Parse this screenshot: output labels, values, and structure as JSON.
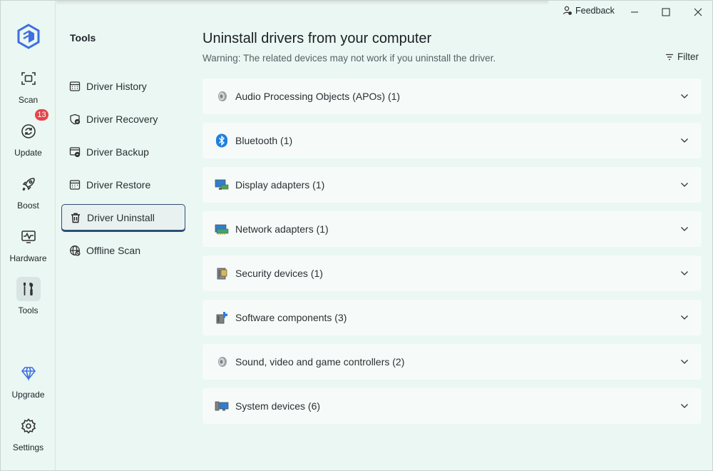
{
  "titlebar": {
    "feedback_label": "Feedback",
    "minimize_icon": "minimize-icon",
    "maximize_icon": "maximize-icon",
    "close_icon": "close-icon"
  },
  "rail": {
    "items": [
      {
        "label": "Scan",
        "icon": "scan-icon"
      },
      {
        "label": "Update",
        "icon": "refresh-icon",
        "badge": "13"
      },
      {
        "label": "Boost",
        "icon": "rocket-icon"
      },
      {
        "label": "Hardware",
        "icon": "monitor-pulse-icon"
      },
      {
        "label": "Tools",
        "icon": "tools-icon",
        "active": true
      },
      {
        "label": "Upgrade",
        "icon": "diamond-icon"
      },
      {
        "label": "Settings",
        "icon": "gear-icon"
      }
    ]
  },
  "tools": {
    "title": "Tools",
    "items": [
      {
        "label": "Driver History",
        "icon": "calendar-icon"
      },
      {
        "label": "Driver Recovery",
        "icon": "shield-check-icon"
      },
      {
        "label": "Driver Backup",
        "icon": "backup-icon"
      },
      {
        "label": "Driver Restore",
        "icon": "restore-icon"
      },
      {
        "label": "Driver Uninstall",
        "icon": "trash-icon",
        "active": true
      },
      {
        "label": "Offline Scan",
        "icon": "offline-globe-icon"
      }
    ]
  },
  "main": {
    "title": "Uninstall drivers from your computer",
    "warning": "Warning: The related devices may not work if you uninstall the driver.",
    "filter_label": "Filter",
    "categories": [
      {
        "label": "Audio Processing Objects (APOs) (1)",
        "icon": "speaker-icon"
      },
      {
        "label": "Bluetooth (1)",
        "icon": "bluetooth-icon"
      },
      {
        "label": "Display adapters (1)",
        "icon": "display-adapter-icon"
      },
      {
        "label": "Network adapters (1)",
        "icon": "network-adapter-icon"
      },
      {
        "label": "Security devices (1)",
        "icon": "security-device-icon"
      },
      {
        "label": "Software components (3)",
        "icon": "software-component-icon"
      },
      {
        "label": "Sound, video and game controllers (2)",
        "icon": "speaker-icon"
      },
      {
        "label": "System devices (6)",
        "icon": "system-device-icon"
      }
    ]
  },
  "colors": {
    "background": "#eaf7f2",
    "card": "#f6fbf9",
    "brand": "#3f6fe0",
    "badge": "#e5454a",
    "active_border": "#2d4e77"
  }
}
